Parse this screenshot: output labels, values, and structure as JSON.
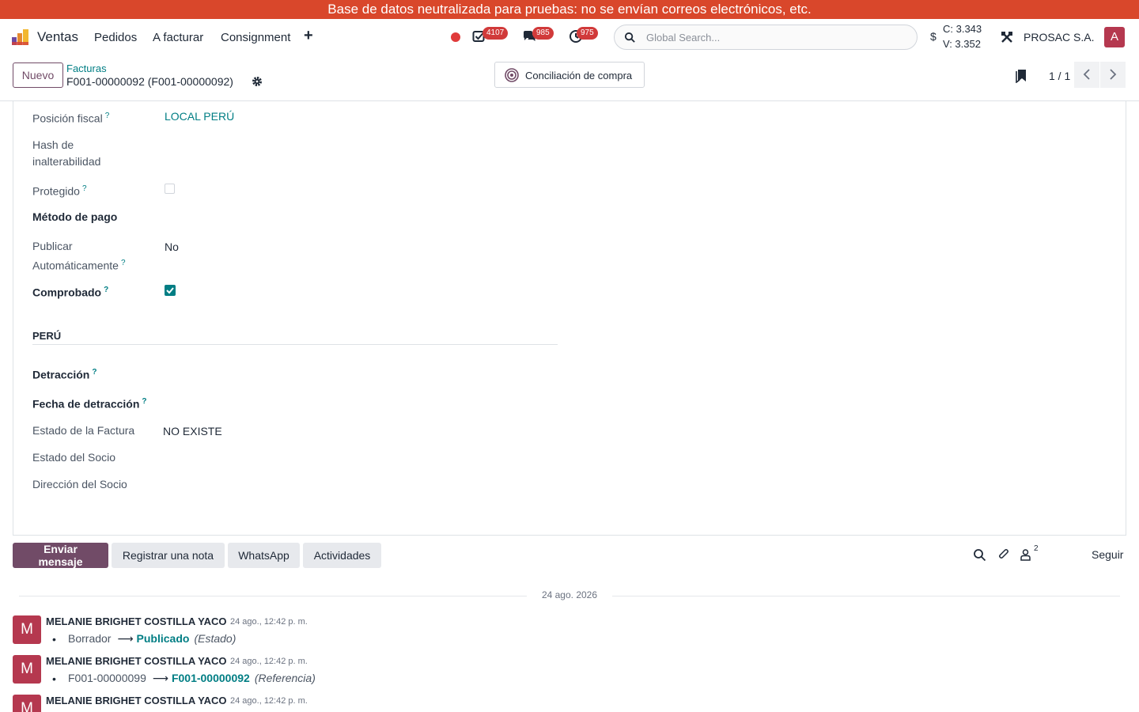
{
  "banner": {
    "text": "Base de datos neutralizada para pruebas: no se envían correos electrónicos, etc."
  },
  "navbar": {
    "app_name": "Ventas",
    "menu": [
      "Pedidos",
      "A facturar",
      "Consignment"
    ],
    "add_icon": "plus-icon",
    "badges": {
      "activities": "4107",
      "messages": "985",
      "clock": "975"
    },
    "search_placeholder": "Global Search...",
    "rate_buy": "C: 3.343",
    "rate_sell": "V: 3.352",
    "company": "PROSAC S.A.",
    "user_initial": "A",
    "colors": {
      "banner": "#d9472b",
      "badge": "#d13a3a",
      "avatar": "#b5384f"
    }
  },
  "control": {
    "new_label": "Nuevo",
    "breadcrumb_parent": "Facturas",
    "breadcrumb_current": "F001-00000092 (F001-00000092)",
    "action_label": "Conciliación de compra",
    "pager": "1 / 1"
  },
  "form": {
    "posicion_fiscal_label": "Posición fiscal",
    "posicion_fiscal_value": "LOCAL PERÚ",
    "hash_label": "Hash de inalterabilidad",
    "protegido_label": "Protegido",
    "protegido_checked": false,
    "metodo_pago_label": "Método de pago",
    "publicar_label": "Publicar Automáticamente",
    "publicar_value": "No",
    "comprobado_label": "Comprobado",
    "comprobado_checked": true,
    "section_peru": "PERÚ",
    "detraccion_label": "Detracción",
    "fecha_detraccion_label": "Fecha de detracción",
    "estado_factura_label": "Estado de la Factura",
    "estado_factura_value": "NO EXISTE",
    "estado_socio_label": "Estado del Socio",
    "direccion_socio_label": "Dirección del Socio",
    "help_mark": "?",
    "accent_color": "#017e84"
  },
  "chatter": {
    "send_message": "Enviar mensaje",
    "log_note": "Registrar una nota",
    "whatsapp": "WhatsApp",
    "activities": "Actividades",
    "followers_count": "2",
    "follow": "Seguir",
    "date_separator": "24 ago. 2026",
    "messages": [
      {
        "initial": "M",
        "author": "MELANIE BRIGHET COSTILLA YACO",
        "time": "24 ago., 12:42 p. m.",
        "old": "Borrador",
        "new": "Publicado",
        "field": "(Estado)"
      },
      {
        "initial": "M",
        "author": "MELANIE BRIGHET COSTILLA YACO",
        "time": "24 ago., 12:42 p. m.",
        "old": "F001-00000099",
        "new": "F001-00000092",
        "field": "(Referencia)"
      },
      {
        "initial": "M",
        "author": "MELANIE BRIGHET COSTILLA YACO",
        "time": "24 ago., 12:42 p. m.",
        "old": "",
        "new": "",
        "field": ""
      }
    ]
  }
}
